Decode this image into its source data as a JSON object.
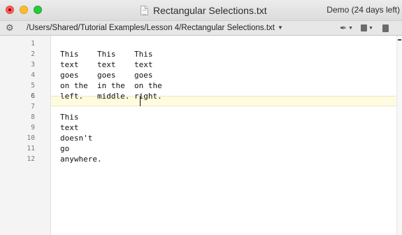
{
  "window": {
    "title": "Rectangular Selections.txt",
    "demo_status": "Demo (24 days left)"
  },
  "pathbar": {
    "path": "/Users/Shared/Tutorial Examples/Lesson 4/Rectangular Selections.txt"
  },
  "editor": {
    "active_line": 6,
    "line_numbers": [
      "1",
      "2",
      "3",
      "4",
      "5",
      "6",
      "7",
      "8",
      "9",
      "10",
      "11",
      "12"
    ],
    "lines": [
      "",
      "This    This    This",
      "text    text    text",
      "goes    goes    goes",
      "on the  in the  on the",
      "left.   middle. right.",
      "",
      "This",
      "text",
      "doesn't",
      "go",
      "anywhere."
    ]
  },
  "icons": {
    "gear": "gear-icon",
    "document": "document-icon",
    "pen": "pen-icon",
    "copy": "copy-icon",
    "page": "page-icon"
  },
  "colors": {
    "close": "#fc5f57",
    "minimize": "#fdbc2e",
    "maximize": "#28c840",
    "current_line": "#fefbe1",
    "gutter": "#f4f4f4"
  }
}
